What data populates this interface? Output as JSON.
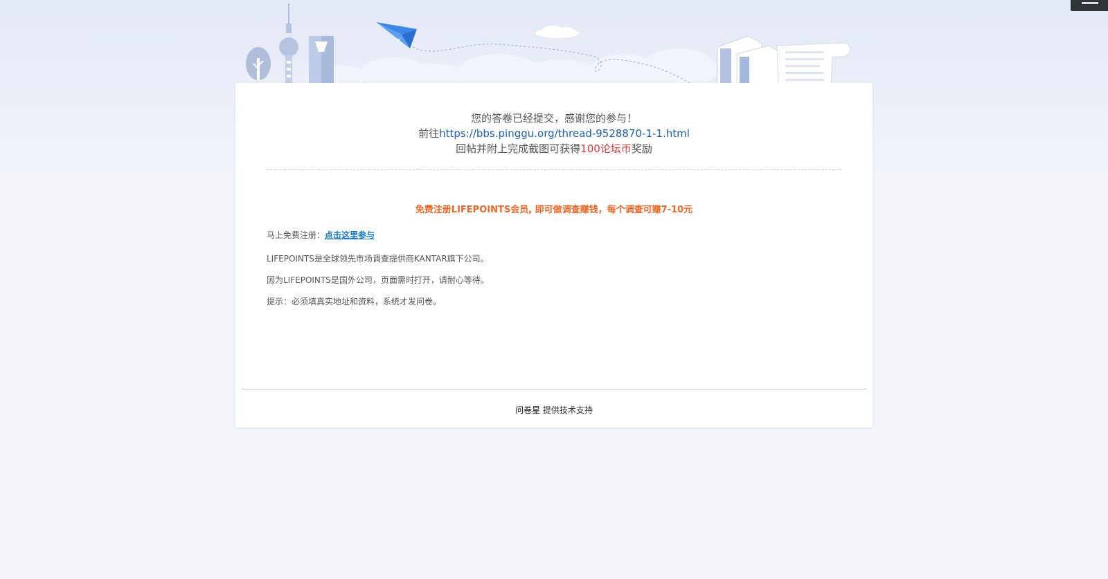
{
  "result": {
    "line1": "您的答卷已经提交，感谢您的参与！",
    "line2_prefix": "前往",
    "line2_link": "https://bbs.pinggu.org/thread-9528870-1-1.html",
    "line3_prefix": "回帖并附上完成截图可获得",
    "line3_reward": "100论坛币",
    "line3_suffix": "奖励"
  },
  "promo": {
    "headline": "免费注册LIFEPOINTS会员, 即可做调查赚钱，每个调查可赚7-10元",
    "register_label": "马上免费注册：",
    "register_link": "点击这里参与",
    "note1": "LIFEPOINTS是全球领先市场调查提供商KANTAR旗下公司。",
    "note2": "因为LIFEPOINTS是国外公司，页面需时打开，请耐心等待。",
    "note3": "提示：必须填真实地址和资料，系统才发问卷。"
  },
  "footer": {
    "brand": "问卷星",
    "text": "提供技术支持"
  },
  "colors": {
    "link": "#1a61b5",
    "reward": "#e8353a",
    "promo": "#f26522",
    "register_link": "#1679c4"
  }
}
